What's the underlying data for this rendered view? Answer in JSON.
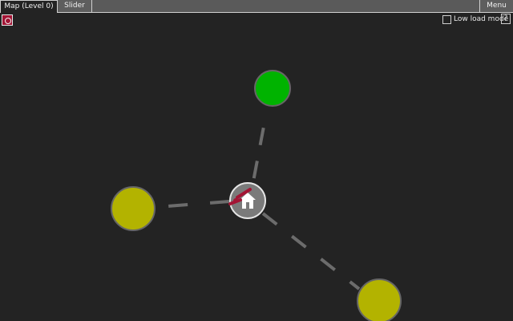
{
  "tabs": [
    {
      "label": "Map (Level 0)",
      "active": true
    },
    {
      "label": "Slider",
      "active": false
    }
  ],
  "menu_label": "Menu",
  "low_load_mode": {
    "label": "Low load mode",
    "checked": false
  },
  "help_label": "?",
  "colors": {
    "background": "#232323",
    "accent": "#a31535",
    "node_green": "#00b300",
    "node_yellow": "#b3b300",
    "node_home": "#7a7a7a",
    "link": "#6c6c6c"
  },
  "map": {
    "home_node": {
      "icon": "home-icon"
    },
    "nodes": [
      {
        "name": "green-node",
        "color": "green"
      },
      {
        "name": "yellow-node-west",
        "color": "yellow"
      },
      {
        "name": "yellow-node-southeast",
        "color": "yellow"
      }
    ]
  }
}
